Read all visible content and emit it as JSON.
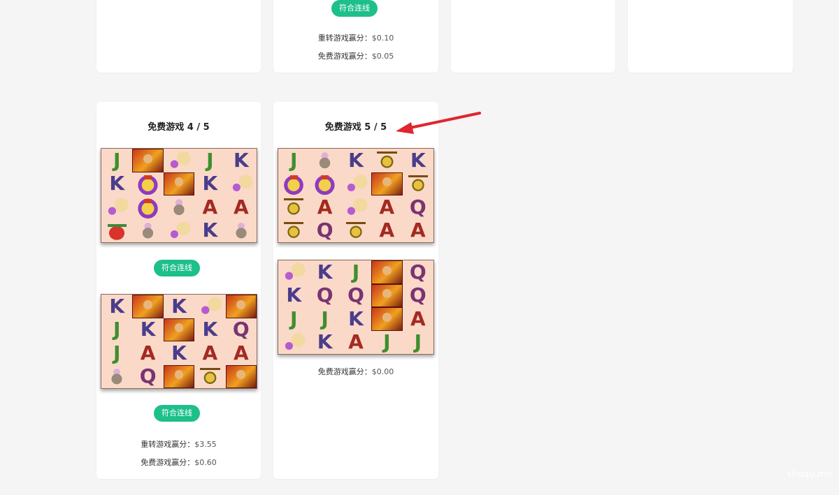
{
  "top_row": {
    "card2": {
      "badge": "符合连线",
      "respin_label": "重转游戏赢分：",
      "respin_value": "$0.10",
      "free_label": "免费游戏赢分：",
      "free_value": "$0.05"
    }
  },
  "card_fg4": {
    "title": "免费游戏 4 / 5",
    "grid1": [
      [
        "J",
        "wukong",
        "fan",
        "J",
        "K"
      ],
      [
        "K",
        "shrine",
        "wukong",
        "K",
        "fan"
      ],
      [
        "fan",
        "shrine",
        "bag",
        "A",
        "A"
      ],
      [
        "lantern",
        "bag",
        "fan",
        "K",
        "bag"
      ]
    ],
    "badge1": "符合连线",
    "grid2": [
      [
        "K",
        "wukong",
        "K",
        "fan",
        "wukong"
      ],
      [
        "J",
        "K",
        "wukong",
        "K",
        "Q"
      ],
      [
        "J",
        "A",
        "K",
        "A",
        "A"
      ],
      [
        "bag",
        "Q",
        "wukong",
        "gong",
        "wukong"
      ]
    ],
    "badge2": "符合连线",
    "respin_label": "重转游戏赢分：",
    "respin_value": "$3.55",
    "free_label": "免费游戏赢分：",
    "free_value": "$0.60"
  },
  "card_fg5": {
    "title": "免费游戏 5 / 5",
    "grid1": [
      [
        "J",
        "bag",
        "K",
        "gong",
        "K"
      ],
      [
        "shrine",
        "shrine",
        "fan",
        "wukong",
        "gong"
      ],
      [
        "gong",
        "A",
        "fan",
        "A",
        "Q"
      ],
      [
        "gong",
        "Q",
        "gong",
        "A",
        "A"
      ]
    ],
    "grid2": [
      [
        "fan",
        "K",
        "J",
        "wukong",
        "Q"
      ],
      [
        "K",
        "Q",
        "Q",
        "wukong",
        "Q"
      ],
      [
        "J",
        "J",
        "K",
        "wukong",
        "A"
      ],
      [
        "fan",
        "K",
        "A",
        "J",
        "J"
      ]
    ],
    "free_label": "免费游戏赢分：",
    "free_value": "$0.00"
  },
  "watermark": "shequ.me",
  "colors": {
    "badge": "#1dbf8a",
    "arrow": "#e0262e",
    "page_bg": "#f5f5f5",
    "grid_bg": "#fbd9c8"
  }
}
